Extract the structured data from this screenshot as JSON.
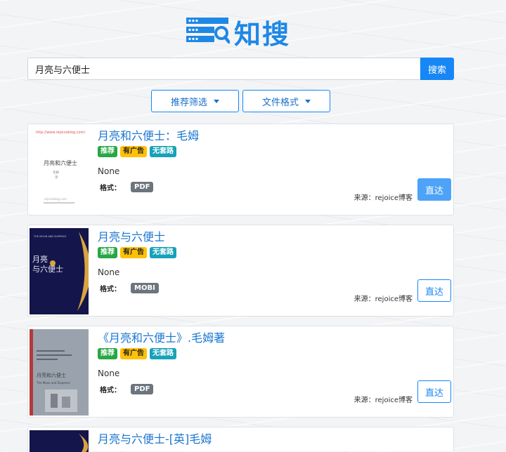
{
  "logo": {
    "text": "知搜",
    "icon": "logo-list-search-icon"
  },
  "search": {
    "value": "月亮与六便士",
    "button_label": "搜索"
  },
  "filters": [
    {
      "label": "推荐筛选"
    },
    {
      "label": "文件格式"
    }
  ],
  "accent_color": "#1687f5",
  "results": [
    {
      "title": "月亮和六便士：毛姆",
      "badges": [
        "推荐",
        "有广告",
        "无套路"
      ],
      "description": "None",
      "format_label": "格式：",
      "format": "PDF",
      "source": "来源：rejoice博客",
      "button_label": "直达",
      "cover": {
        "url_text": "http://www.rejoiceblog.com/",
        "title_text": "月亮和六便士",
        "line1": "毛姆",
        "line2": "译",
        "line3": "rejoiceblog.com"
      }
    },
    {
      "title": "月亮与六便士",
      "badges": [
        "推荐",
        "有广告",
        "无套路"
      ],
      "description": "None",
      "format_label": "格式：",
      "format": "MOBI",
      "source": "来源：rejoice博客",
      "button_label": "直达",
      "cover": {
        "top_text": "THE MOON AND SIXPENCE",
        "title_line1": "月亮",
        "title_line2": "与六便士"
      }
    },
    {
      "title": "《月亮和六便士》.毛姆著",
      "badges": [
        "推荐",
        "有广告",
        "无套路"
      ],
      "description": "None",
      "format_label": "格式：",
      "format": "PDF",
      "source": "来源：rejoice博客",
      "button_label": "直达",
      "cover": {
        "title_text": "月亮和六便士",
        "subtitle_text": "The Moon and Sixpence"
      }
    },
    {
      "title": "月亮与六便士-[英]毛姆"
    }
  ]
}
